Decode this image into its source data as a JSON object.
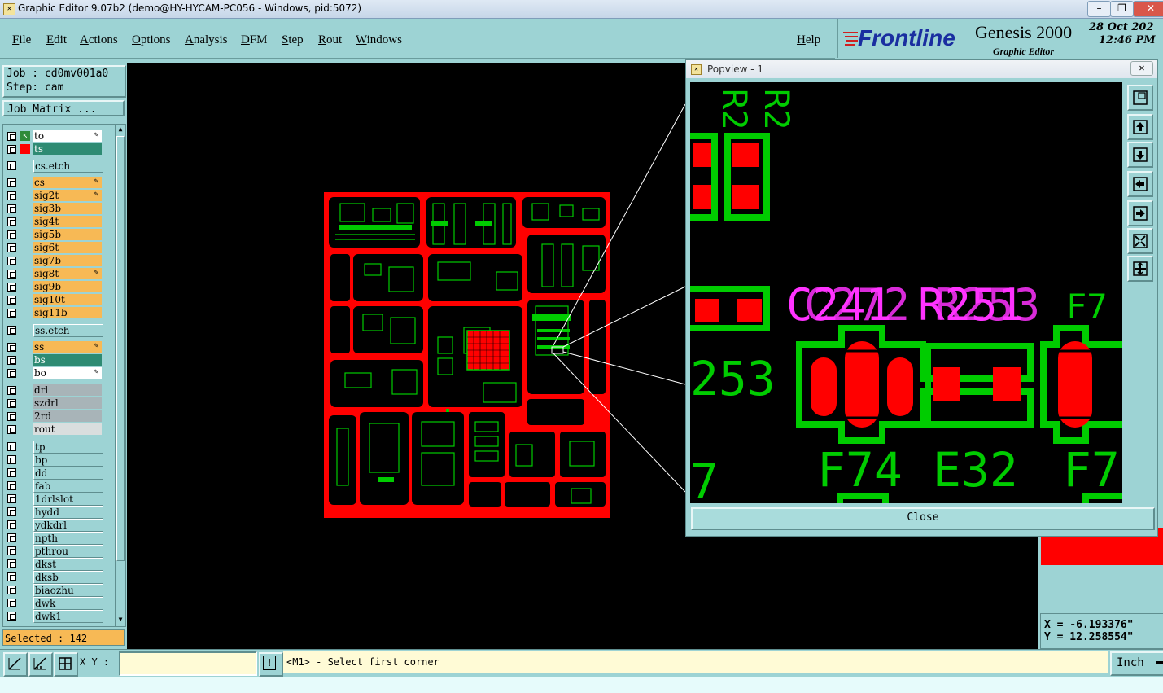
{
  "window": {
    "title": "Graphic Editor 9.07b2 (demo@HY-HYCAM-PC056 - Windows, pid:5072)",
    "minimize": "–",
    "maximize": "❐",
    "close": "✕"
  },
  "menu": {
    "items": [
      "File",
      "Edit",
      "Actions",
      "Options",
      "Analysis",
      "DFM",
      "Step",
      "Rout",
      "Windows"
    ],
    "help": "Help"
  },
  "brand": {
    "logo": "Frontline",
    "product": "Genesis 2000",
    "subtitle": "Graphic Editor",
    "date": "28 Oct 202",
    "time": "12:46 PM"
  },
  "job": {
    "job_label": "Job  : cd0mv001a0",
    "step_label": "Step: cam",
    "matrix_button": "Job Matrix ..."
  },
  "layers": [
    {
      "name": "to",
      "color": "white",
      "editable": true
    },
    {
      "name": "ts",
      "color": "green",
      "editable": false
    },
    {
      "name": "cs.etch",
      "color": "teal",
      "editable": false
    },
    {
      "name": "cs",
      "color": "orange",
      "editable": true
    },
    {
      "name": "sig2t",
      "color": "orange",
      "editable": true
    },
    {
      "name": "sig3b",
      "color": "orange",
      "editable": false
    },
    {
      "name": "sig4t",
      "color": "orange",
      "editable": false
    },
    {
      "name": "sig5b",
      "color": "orange",
      "editable": false
    },
    {
      "name": "sig6t",
      "color": "orange",
      "editable": false
    },
    {
      "name": "sig7b",
      "color": "orange",
      "editable": false
    },
    {
      "name": "sig8t",
      "color": "orange",
      "editable": true
    },
    {
      "name": "sig9b",
      "color": "orange",
      "editable": false
    },
    {
      "name": "sig10t",
      "color": "orange",
      "editable": false
    },
    {
      "name": "sig11b",
      "color": "orange",
      "editable": false
    },
    {
      "name": "ss.etch",
      "color": "teal",
      "editable": false
    },
    {
      "name": "ss",
      "color": "orange",
      "editable": true
    },
    {
      "name": "bs",
      "color": "green",
      "editable": false
    },
    {
      "name": "bo",
      "color": "white",
      "editable": true
    },
    {
      "name": "drl",
      "color": "gray",
      "editable": false
    },
    {
      "name": "szdrl",
      "color": "gray",
      "editable": false
    },
    {
      "name": "2rd",
      "color": "gray",
      "editable": false
    },
    {
      "name": "rout",
      "color": "lgray",
      "editable": false
    },
    {
      "name": "tp",
      "color": "teal",
      "editable": false
    },
    {
      "name": "bp",
      "color": "teal",
      "editable": false
    },
    {
      "name": "dd",
      "color": "teal",
      "editable": false
    },
    {
      "name": "fab",
      "color": "teal",
      "editable": false
    },
    {
      "name": "1drlslot",
      "color": "teal",
      "editable": false
    },
    {
      "name": "hydd",
      "color": "teal",
      "editable": false
    },
    {
      "name": "ydkdrl",
      "color": "teal",
      "editable": false
    },
    {
      "name": "npth",
      "color": "teal",
      "editable": false
    },
    {
      "name": "pthrou",
      "color": "teal",
      "editable": false
    },
    {
      "name": "dkst",
      "color": "teal",
      "editable": false
    },
    {
      "name": "dksb",
      "color": "teal",
      "editable": false
    },
    {
      "name": "biaozhu",
      "color": "teal",
      "editable": false
    },
    {
      "name": "dwk",
      "color": "teal",
      "editable": false
    },
    {
      "name": "dwk1",
      "color": "teal",
      "editable": false
    }
  ],
  "selected": "Selected : 142",
  "popview": {
    "title": "Popview - 1",
    "close_button": "Close",
    "labels": {
      "c241": "C241",
      "c271": "C272",
      "r251": "R251",
      "r253": "R253",
      "f7a": "F7",
      "n253": "253",
      "f74": "F74",
      "e32": "E32",
      "f7b": "F7",
      "n7": "7",
      "r2a": "R2",
      "r2b": "R2"
    }
  },
  "coordinates": {
    "x": "X = -6.193376\"",
    "y": "Y = 12.258554\""
  },
  "bottom": {
    "xy_label": "X Y :",
    "xy_value": "",
    "message": "<M1> - Select first corner",
    "unit": "Inch"
  },
  "colors": {
    "panel": "#9dd3d4",
    "copper": "#ff0000",
    "silk": "#00cc00",
    "label": "#ff33ff"
  }
}
